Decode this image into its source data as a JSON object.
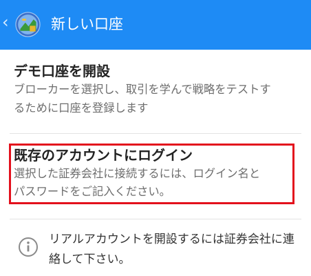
{
  "header": {
    "title": "新しい口座",
    "back_glyph": "‹",
    "background": "#1e8bf5"
  },
  "options": {
    "demo": {
      "title": "デモ口座を開設",
      "desc_line1": "ブローカーを選択し、取引を学んで戦略をテストす",
      "desc_line2": "るために口座を登録します"
    },
    "existing": {
      "title": "既存のアカウントにログイン",
      "desc_line1": "選択した証券会社に接続するには、ログイン名と",
      "desc_line2": "パスワードをご記入ください。",
      "highlight_color": "#e3101c"
    }
  },
  "info": {
    "icon": "info-icon",
    "line1": "リアルアカウントを開設するには証券会社に連",
    "line2": "絡して下さい。"
  }
}
